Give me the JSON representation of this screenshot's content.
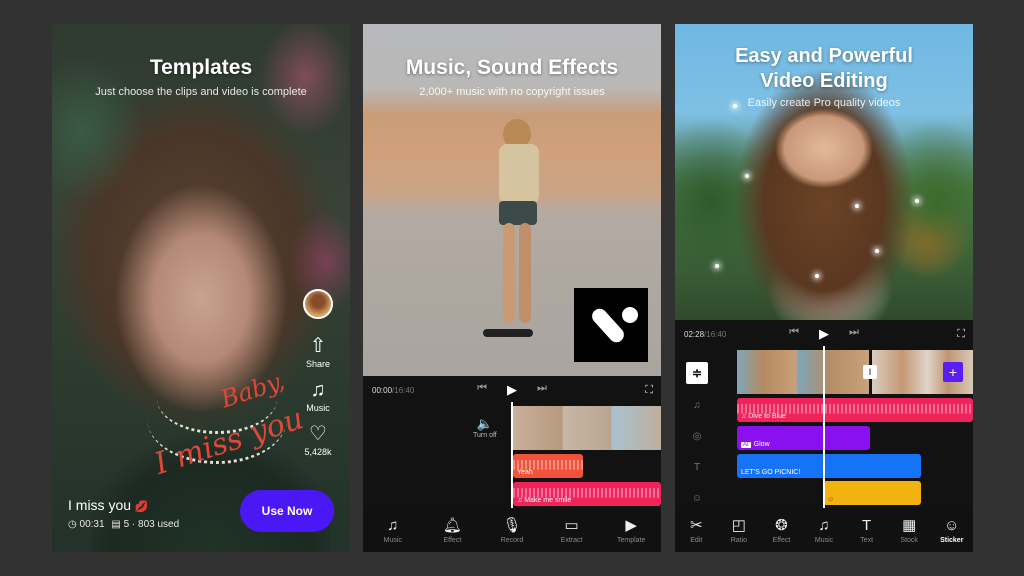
{
  "panels": {
    "templates": {
      "title": "Templates",
      "subtitle": "Just choose the clips and video is complete",
      "overlay_text": {
        "line1": "Baby,",
        "line2": "I miss you"
      },
      "side_actions": [
        {
          "icon": "share-icon",
          "label": "Share"
        },
        {
          "icon": "music-add-icon",
          "label": "Music"
        },
        {
          "icon": "heart-icon",
          "label": "5,428k"
        }
      ],
      "template_name": "I miss you",
      "template_emoji": "💋",
      "duration": "00:31",
      "clip_count": "5",
      "used_count": "803 used",
      "use_now_label": "Use Now",
      "accent_color": "#4a17f5"
    },
    "music": {
      "title": "Music, Sound Effects",
      "subtitle": "2,000+ music with no copyright issues",
      "current_time": "00:00",
      "total_time": "/16:40",
      "volume_label": "Turn off",
      "tracks": [
        {
          "label": "Yeah",
          "color": "#f0523a"
        },
        {
          "label": "♫ Make me smile",
          "color": "#f0245a"
        }
      ],
      "bottom_nav": [
        {
          "icon": "music-add-icon",
          "label": "Music"
        },
        {
          "icon": "bell-add-icon",
          "label": "Effect"
        },
        {
          "icon": "mic-icon",
          "label": "Record"
        },
        {
          "icon": "extract-icon",
          "label": "Extract"
        },
        {
          "icon": "template-icon",
          "label": "Template"
        }
      ]
    },
    "editing": {
      "title_line1": "Easy and Powerful",
      "title_line2": "Video Editing",
      "subtitle": "Easily create Pro quality videos",
      "current_time": "02:28",
      "total_time": "/16:40",
      "tracks": [
        {
          "type": "music",
          "label": "♫ Dive to Blue",
          "color": "#f0245a"
        },
        {
          "type": "effect",
          "badge": "AI",
          "label": "Glow",
          "color": "#8a10f0"
        },
        {
          "type": "text",
          "label": "LET'S GO PICNIC!",
          "color": "#1673f5"
        },
        {
          "type": "sticker",
          "label": "",
          "color": "#f2b20f"
        }
      ],
      "bottom_nav": [
        {
          "icon": "scissors-icon",
          "label": "Edit"
        },
        {
          "icon": "ratio-icon",
          "label": "Ratio"
        },
        {
          "icon": "effect-icon",
          "label": "Effect"
        },
        {
          "icon": "music-icon",
          "label": "Music"
        },
        {
          "icon": "text-icon",
          "label": "Text"
        },
        {
          "icon": "stock-icon",
          "label": "Stock"
        },
        {
          "icon": "sticker-icon",
          "label": "Sticker"
        }
      ],
      "active_nav": "Sticker"
    }
  }
}
